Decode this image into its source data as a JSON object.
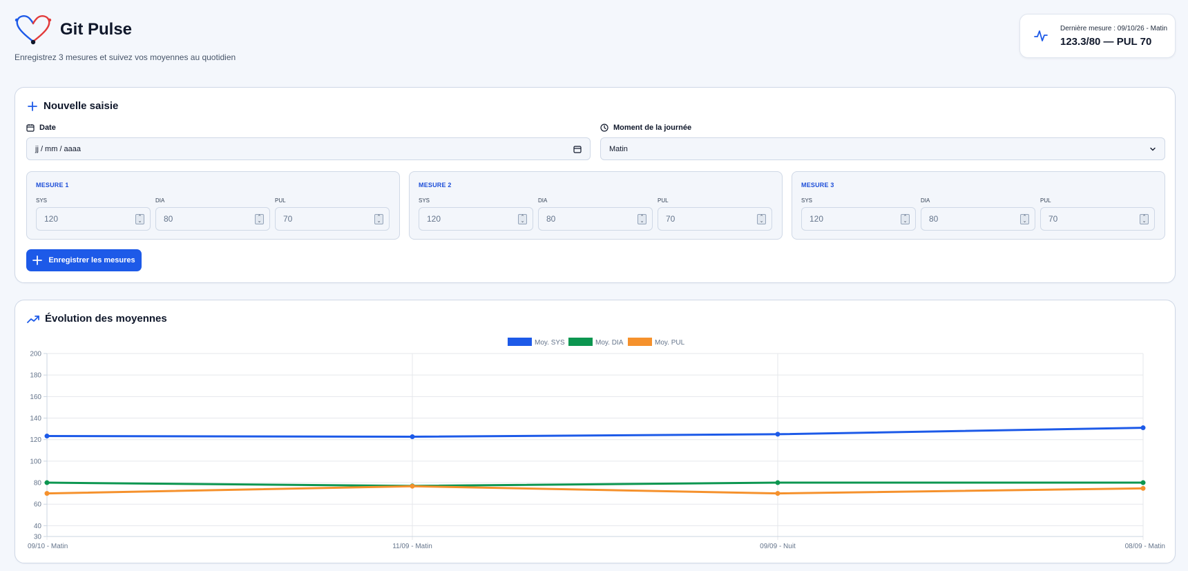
{
  "app": {
    "title": "Git Pulse",
    "subtitle": "Enregistrez 3 mesures et suivez vos moyennes au quotidien",
    "logo_icon": "heart-stethoscope-icon"
  },
  "last_measure": {
    "label": "Dernière mesure : 09/10/26 - Matin",
    "value": "123.3/80 — PUL 70",
    "icon": "pulse-icon"
  },
  "entry": {
    "title": "Nouvelle saisie",
    "date_label": "Date",
    "date_placeholder": "jj / mm / aaaa",
    "moment_label": "Moment de la journée",
    "moment_value": "Matin",
    "mesures": [
      {
        "title": "MESURE 1",
        "sys_label": "SYS",
        "dia_label": "DIA",
        "pul_label": "PUL",
        "sys": "120",
        "dia": "80",
        "pul": "70"
      },
      {
        "title": "MESURE 2",
        "sys_label": "SYS",
        "dia_label": "DIA",
        "pul_label": "PUL",
        "sys": "120",
        "dia": "80",
        "pul": "70"
      },
      {
        "title": "MESURE 3",
        "sys_label": "SYS",
        "dia_label": "DIA",
        "pul_label": "PUL",
        "sys": "120",
        "dia": "80",
        "pul": "70"
      }
    ],
    "save_label": "Enregistrer les mesures"
  },
  "chart_section": {
    "title": "Évolution des moyennes"
  },
  "chart_data": {
    "type": "line",
    "title": "",
    "xlabel": "",
    "ylabel": "",
    "categories": [
      "09/10 - Matin",
      "11/09 - Matin",
      "09/09 - Nuit",
      "08/09 - Matin"
    ],
    "series": [
      {
        "name": "Moy. SYS",
        "color": "#1d5ae8",
        "values": [
          123.3,
          122.7,
          125,
          131
        ]
      },
      {
        "name": "Moy. DIA",
        "color": "#0c9650",
        "values": [
          80,
          77,
          80,
          80
        ]
      },
      {
        "name": "Moy. PUL",
        "color": "#f5912c",
        "values": [
          70,
          76.7,
          70,
          74.7
        ]
      }
    ],
    "ylim": [
      30,
      200
    ],
    "yticks": [
      30,
      40,
      60,
      80,
      100,
      120,
      140,
      160,
      180,
      200
    ],
    "grid": true,
    "legend": "top-center"
  }
}
